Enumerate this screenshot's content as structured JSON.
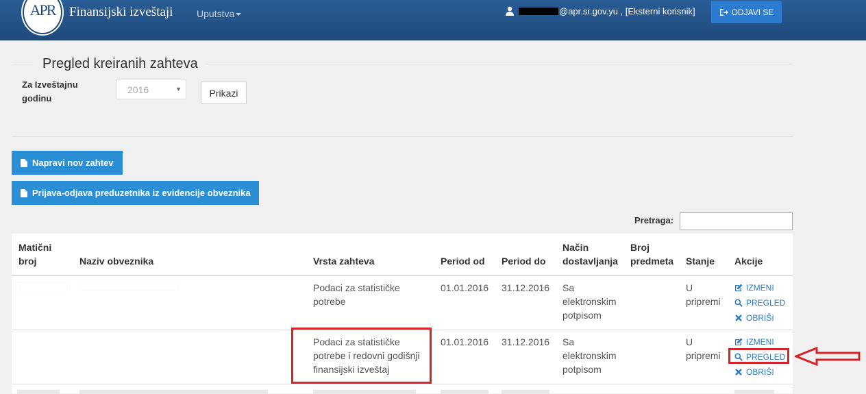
{
  "header": {
    "logo_text": "APR",
    "brand": "Finansijski izveštaji",
    "guide_menu": "Uputstva",
    "user_email": "@apr.sr.gov.yu , [Eksterni korisnik]",
    "logout_label": "ODJAVI SE"
  },
  "page": {
    "title": "Pregled kreiranih zahteva",
    "year_label": "Za Izveštajnu godinu",
    "year_value": "2016",
    "show_button": "Prikazi",
    "new_request_button": "Napravi nov zahtev",
    "register_button": "Prijava-odjava preduzetnika iz evidencije obveznika",
    "search_label": "Pretraga:",
    "search_value": ""
  },
  "table": {
    "columns": {
      "mb": "Matični broj",
      "name": "Naziv obveznika",
      "type": "Vrsta zahteva",
      "from": "Period od",
      "to": "Period do",
      "delivery": "Način dostavljanja",
      "subject": "Broj predmeta",
      "status": "Stanje",
      "actions": "Akcije"
    },
    "rows": [
      {
        "type": "Podaci za statističke potrebe",
        "from": "01.01.2016",
        "to": "31.12.2016",
        "delivery": "Sa elektronskim potpisom",
        "status": "U pripremi",
        "edit": "IZMENI",
        "view": "PREGLED",
        "delete": "OBRIŠI"
      },
      {
        "type": "Podaci za statističke potrebe i redovni godišnji finansijski izveštaj",
        "from": "01.01.2016",
        "to": "31.12.2016",
        "delivery": "Sa elektronskim potpisom",
        "status": "U pripremi",
        "edit": "IZMENI",
        "view": "PREGLED",
        "delete": "OBRIŠI"
      }
    ]
  },
  "colors": {
    "navbar": "#1f4a7c",
    "primary_button": "#2b8fd6",
    "link": "#2a7bc8",
    "highlight": "#d3232b"
  }
}
